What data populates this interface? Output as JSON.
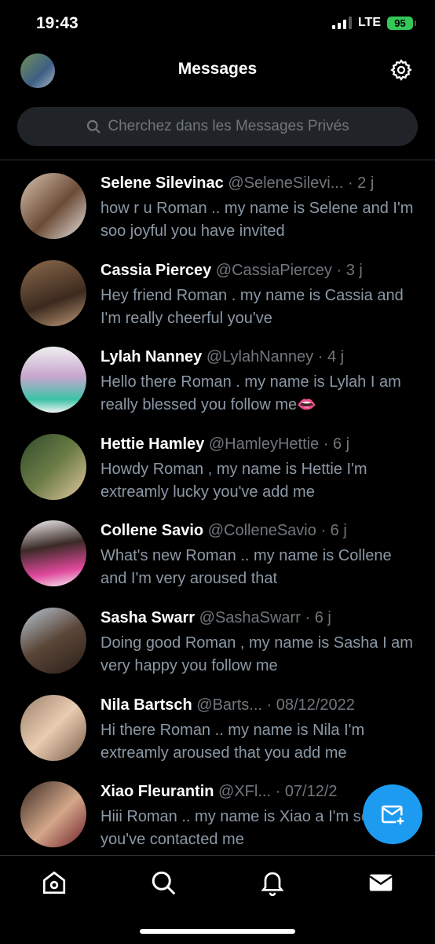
{
  "status": {
    "time": "19:43",
    "network": "LTE",
    "battery": "95"
  },
  "header": {
    "title": "Messages"
  },
  "search": {
    "placeholder": "Cherchez dans les Messages Privés"
  },
  "conversations": [
    {
      "name": "Selene Silevinac",
      "handle": "@SeleneSilevi...",
      "date": "2 j",
      "preview": "how r u Roman .. my name is Selene and I'm soo joyful you have invited"
    },
    {
      "name": "Cassia Piercey",
      "handle": "@CassiaPiercey",
      "date": "3 j",
      "preview": "Hey friend Roman . my name is Cassia and I'm really cheerful you've"
    },
    {
      "name": "Lylah Nanney",
      "handle": "@LylahNanney",
      "date": "4 j",
      "preview": "Hello there Roman . my name is Lylah I am really blessed you follow me👄"
    },
    {
      "name": "Hettie Hamley",
      "handle": "@HamleyHettie",
      "date": "6 j",
      "preview": "Howdy Roman , my name is Hettie I'm extreamly lucky you've add me"
    },
    {
      "name": "Collene Savio",
      "handle": "@ColleneSavio",
      "date": "6 j",
      "preview": "What's new Roman .. my name is Collene and I'm very aroused that"
    },
    {
      "name": "Sasha Swarr",
      "handle": "@SashaSwarr",
      "date": "6 j",
      "preview": "Doing good Roman , my name is Sasha I am very happy you follow me"
    },
    {
      "name": "Nila Bartsch",
      "handle": "@Barts...",
      "date": "08/12/2022",
      "preview": "Hi there Roman .. my name is Nila I'm extreamly aroused that you add me"
    },
    {
      "name": "Xiao Fleurantin",
      "handle": "@XFl...",
      "date": "07/12/2",
      "preview": "Hiii Roman .. my name is Xiao a I'm so happy you've contacted me"
    }
  ],
  "nav": [
    "home-icon",
    "search-icon",
    "notifications-icon",
    "messages-icon"
  ],
  "colors": {
    "accent": "#1d9bf0",
    "background": "#000000",
    "muted": "#71767b"
  }
}
